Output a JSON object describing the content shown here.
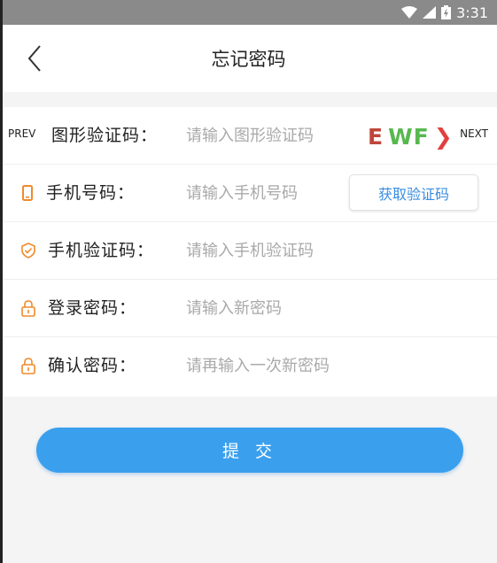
{
  "status_bar": {
    "time": "3:31"
  },
  "header": {
    "title": "忘记密码"
  },
  "form": {
    "captcha": {
      "prev_label": "PREV",
      "label": "图形验证码：",
      "placeholder": "请输入图形验证码",
      "image_chars": [
        "E",
        "WF",
        "❯"
      ],
      "next_label": "NEXT"
    },
    "phone": {
      "label": "手机号码：",
      "placeholder": "请输入手机号码",
      "get_code_label": "获取验证码"
    },
    "sms_code": {
      "label": "手机验证码：",
      "placeholder": "请输入手机验证码"
    },
    "login_password": {
      "label": "登录密码：",
      "placeholder": "请输入新密码"
    },
    "confirm_password": {
      "label": "确认密码：",
      "placeholder": "请再输入一次新密码"
    }
  },
  "submit": {
    "label": "提 交"
  },
  "colors": {
    "accent": "#3aa0ee",
    "icon_orange": "#f08a2c",
    "status_bar": "#8a8a8a",
    "link_blue": "#3a8de0"
  }
}
